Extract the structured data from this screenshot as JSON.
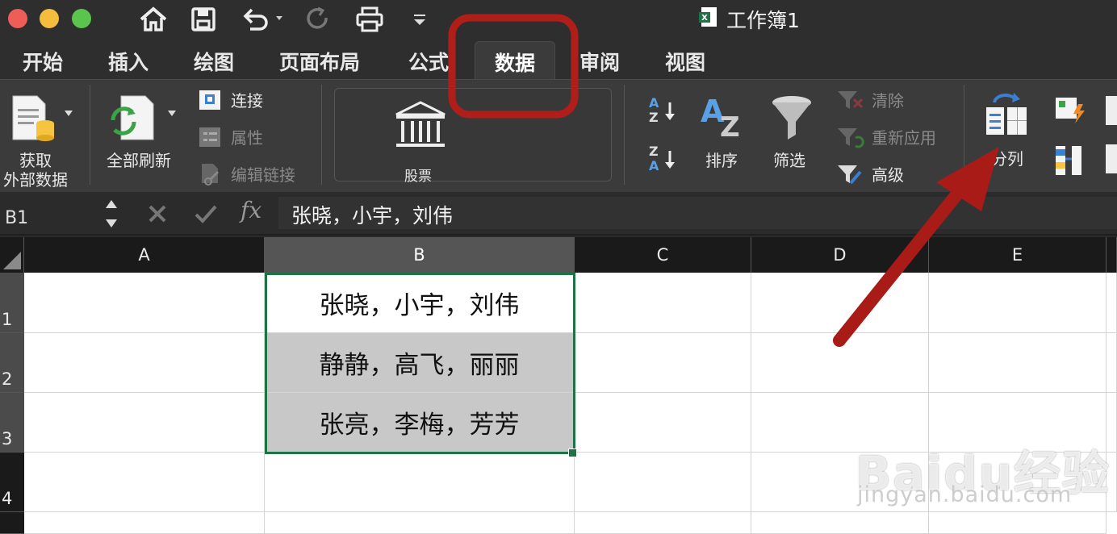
{
  "window": {
    "title": "工作簿1",
    "buttons": [
      "close",
      "minimize",
      "zoom"
    ]
  },
  "quick_access": {
    "icons": [
      "home-icon",
      "save-icon",
      "undo-icon",
      "redo-icon",
      "print-icon",
      "customize-icon"
    ]
  },
  "tabs": [
    {
      "label": "开始"
    },
    {
      "label": "插入"
    },
    {
      "label": "绘图"
    },
    {
      "label": "页面布局"
    },
    {
      "label": "公式"
    },
    {
      "label": "数据",
      "active": true
    },
    {
      "label": "审阅"
    },
    {
      "label": "视图"
    }
  ],
  "ribbon": {
    "get_external_data": {
      "line1": "获取",
      "line2": "外部数据"
    },
    "refresh_all": "全部刷新",
    "connections": "连接",
    "properties": "属性",
    "edit_links": "编辑链接",
    "stocks": "股票",
    "sort": "排序",
    "filter": "筛选",
    "clear": "清除",
    "reapply": "重新应用",
    "advanced": "高级",
    "text_to_columns": "分列"
  },
  "formula_bar": {
    "name_box": "B1",
    "fx": "fx",
    "value": "张晓，小宇，刘伟"
  },
  "sheet": {
    "columns": [
      "A",
      "B",
      "C",
      "D",
      "E"
    ],
    "rows": [
      "1",
      "2",
      "3",
      "4"
    ],
    "cells": {
      "B1": "张晓，小宇，刘伟",
      "B2": "静静，高飞，丽丽",
      "B3": "张亮，李梅，芳芳"
    }
  },
  "annotation": {
    "highlight_color": "#b01e1a",
    "arrow_color": "#a91b17"
  },
  "watermark": {
    "brand": "Baidu经验",
    "url": "jingyan.baidu.com"
  },
  "colors": {
    "selection": "#1f7244",
    "excel_green": "#1f7244"
  }
}
